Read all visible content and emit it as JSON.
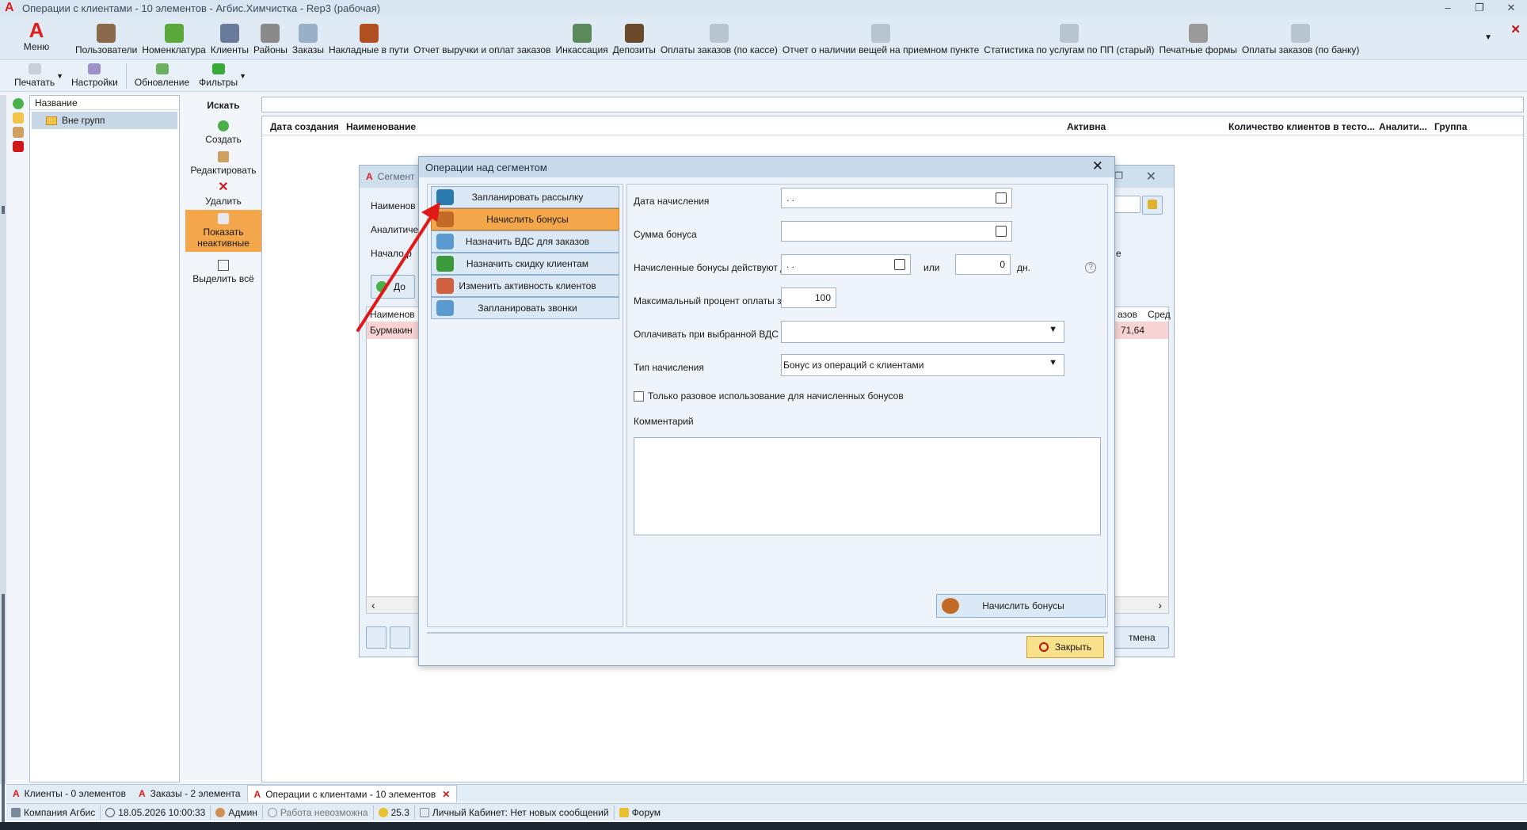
{
  "window": {
    "title": "Операции с клиентами - 10 элементов - Агбис.Химчистка - Rep3 (рабочая)",
    "logo": "A",
    "controls": [
      "–",
      "❐",
      "✕"
    ]
  },
  "ribbon": {
    "menu_label": "Меню",
    "items": [
      {
        "label": "Пользователи",
        "icon": "users-icon",
        "color": "#8a6a4a"
      },
      {
        "label": "Номенклатура",
        "icon": "nomenclature-icon",
        "color": "#5aa83a"
      },
      {
        "label": "Клиенты",
        "icon": "clients-icon",
        "color": "#6a7a9a"
      },
      {
        "label": "Районы",
        "icon": "districts-icon",
        "color": "#8a8a8a"
      },
      {
        "label": "Заказы",
        "icon": "orders-icon",
        "color": "#9ab0c8"
      },
      {
        "label": "Накладные в пути",
        "icon": "waybills-icon",
        "color": "#b05020"
      },
      {
        "label": "Отчет выручки и оплат заказов",
        "icon": "report-icon",
        "color": "#dfeaf5"
      },
      {
        "label": "Инкассация",
        "icon": "collection-icon",
        "color": "#5a8a5a"
      },
      {
        "label": "Депозиты",
        "icon": "deposits-icon",
        "color": "#6a4a2a"
      },
      {
        "label": "Оплаты заказов (по кассе)",
        "icon": "payments-cash-icon",
        "color": "#b8c4d0"
      },
      {
        "label": "Отчет о наличии вещей на приемном пункте",
        "icon": "items-report-icon",
        "color": "#b8c4d0"
      },
      {
        "label": "Статистика по услугам по ПП (старый)",
        "icon": "stats-icon",
        "color": "#b8c4d0"
      },
      {
        "label": "Печатные формы",
        "icon": "print-forms-icon",
        "color": "#9a9a9a"
      },
      {
        "label": "Оплаты заказов (по банку)",
        "icon": "payments-bank-icon",
        "color": "#b8c4d0"
      }
    ]
  },
  "toolbar": {
    "print": "Печатать",
    "settings": "Настройки",
    "refresh": "Обновление",
    "filters": "Фильтры"
  },
  "group_tree": {
    "header": "Название",
    "items": [
      "Вне групп"
    ]
  },
  "actions": {
    "search": "Искать",
    "create": "Создать",
    "edit": "Редактировать",
    "delete": "Удалить",
    "show_inactive": "Показать неактивные",
    "select_all": "Выделить всё"
  },
  "main_grid": {
    "columns": [
      "Дата создания",
      "Наименование",
      "Активна",
      "Количество клиентов в тесто...",
      "Аналити...",
      "Группа"
    ]
  },
  "bg_window": {
    "title": "Сегмент",
    "name_label": "Наименов",
    "analytics_label": "Аналитиче",
    "start_label": "Начало р",
    "right_frag": "е",
    "add_btn": "До",
    "grid_col": "Наименов",
    "grid_col_r1": "азов",
    "grid_col_r2": "Сред",
    "row_name": "Бурмакин",
    "row_value": "71,64",
    "cancel_frag": "тмена"
  },
  "dialog": {
    "title": "Операции над сегментом",
    "operations": [
      {
        "label": "Запланировать рассылку",
        "icon": "mailing-icon",
        "color": "#2a7ab0"
      },
      {
        "label": "Начислить бонусы",
        "icon": "bonus-icon",
        "color": "#c46a28",
        "active": true
      },
      {
        "label": "Назначить ВДС для заказов",
        "icon": "vds-icon",
        "color": "#5a9ad0"
      },
      {
        "label": "Назначить скидку клиентам",
        "icon": "percent-icon",
        "color": "#3a9a3a"
      },
      {
        "label": "Изменить активность клиентов",
        "icon": "client-activity-icon",
        "color": "#d06040"
      },
      {
        "label": "Запланировать звонки",
        "icon": "phone-icon",
        "color": "#5a9ad0"
      }
    ],
    "form": {
      "accrual_date_label": "Дата начисления",
      "accrual_date_value": ". .",
      "bonus_amount_label": "Сумма бонуса",
      "bonus_amount_value": "",
      "valid_until_label": "Начисленные бонусы действуют до",
      "valid_until_value": ". .",
      "or_label": "или",
      "days_value": "0",
      "days_unit": "дн.",
      "max_percent_label": "Максимальный процент оплаты заказа",
      "max_percent_value": "100",
      "pay_vds_label": "Оплачивать при выбранной ВДС",
      "pay_vds_value": "",
      "accrual_type_label": "Тип начисления",
      "accrual_type_value": "Бонус из операций с клиентами",
      "one_time_label": "Только разовое использование для начисленных бонусов",
      "one_time_checked": false,
      "comment_label": "Комментарий",
      "comment_value": "",
      "help": "?"
    },
    "accrue_button": "Начислить бонусы",
    "close_button": "Закрыть"
  },
  "tabs": [
    {
      "label": "Клиенты - 0 элементов",
      "active": false
    },
    {
      "label": "Заказы - 2 элемента",
      "active": false
    },
    {
      "label": "Операции с клиентами - 10 элементов",
      "active": true
    }
  ],
  "status": {
    "company": "Компания Агбис",
    "datetime": "18.05.2026 10:00:33",
    "user": "Админ",
    "work": "Работа невозможна",
    "version": "25.3",
    "cabinet": "Личный Кабинет: Нет новых сообщений",
    "forum": "Форум"
  },
  "colors": {
    "accent_orange": "#f3a64a",
    "annotation_arrow": "#e01818"
  }
}
